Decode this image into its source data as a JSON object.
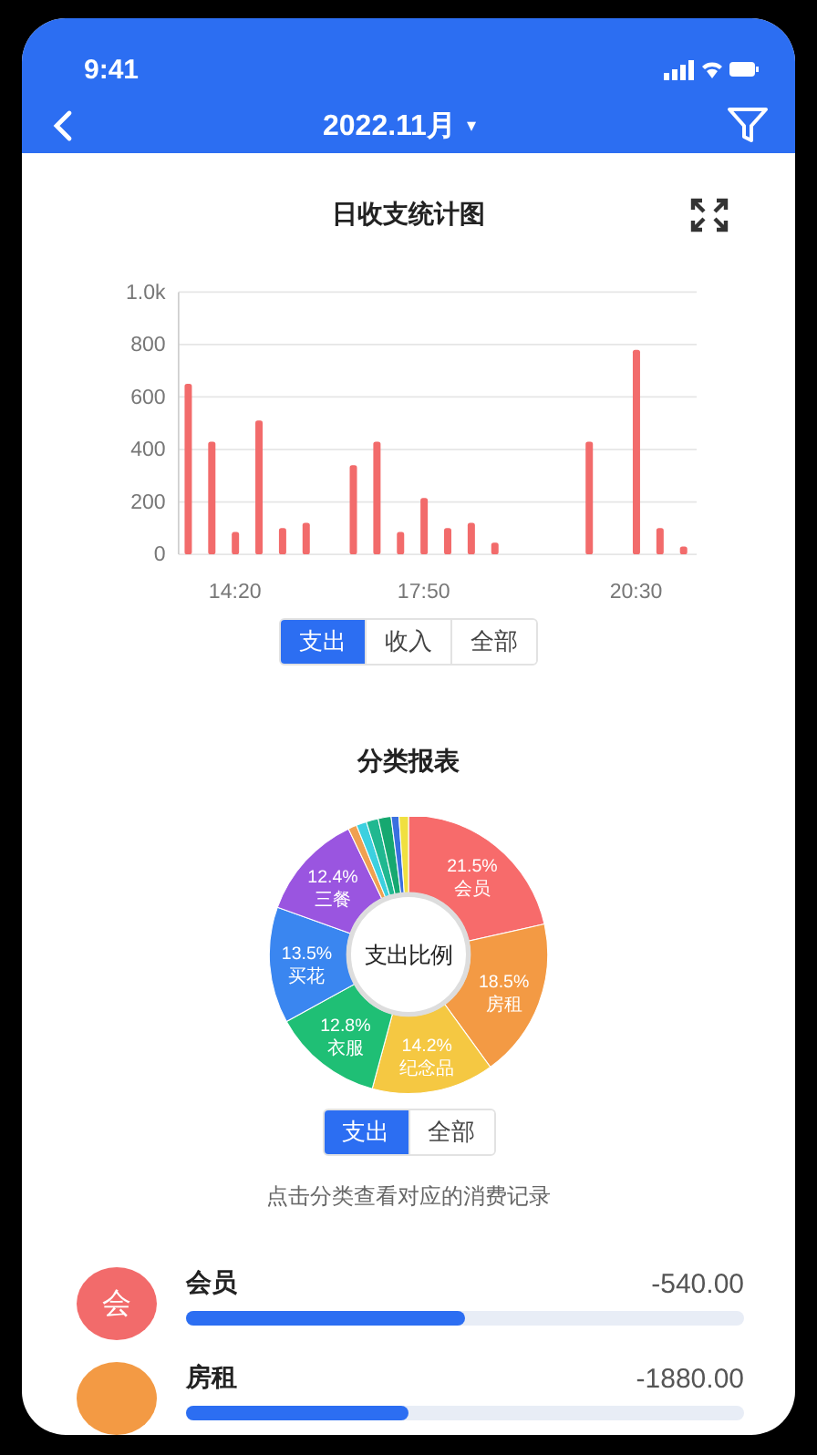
{
  "status_bar": {
    "time": "9:41"
  },
  "nav": {
    "title": "2022.11月",
    "caret": "▾"
  },
  "daily_chart": {
    "title": "日收支统计图",
    "chart_data": {
      "type": "bar",
      "grid": true,
      "categories": [
        null,
        null,
        "14:20",
        null,
        null,
        null,
        null,
        null,
        null,
        null,
        "17:50",
        null,
        null,
        null,
        null,
        null,
        null,
        null,
        null,
        "20:30",
        null,
        null
      ],
      "series": [
        {
          "color": "#f26b6b",
          "values": [
            650,
            430,
            85,
            510,
            100,
            120,
            null,
            340,
            430,
            85,
            215,
            100,
            120,
            45,
            null,
            null,
            null,
            430,
            null,
            780,
            100,
            30
          ]
        }
      ],
      "ylim": [
        0,
        1000
      ],
      "yticks": [
        0,
        200,
        400,
        600,
        800,
        {
          "value": 1000,
          "label": "1.0k"
        }
      ]
    }
  },
  "chart_tabs": [
    {
      "label": "支出",
      "selected": true
    },
    {
      "label": "收入",
      "selected": false
    },
    {
      "label": "全部",
      "selected": false
    }
  ],
  "category_report": {
    "title": "分类报表",
    "chart_data": {
      "type": "donut",
      "title": "支出比例",
      "categories": [
        "会员",
        "房租",
        "纪念品",
        "衣服",
        "买花",
        "三餐",
        null,
        null,
        null,
        null,
        null,
        null
      ],
      "values": [
        21.5,
        18.5,
        14.2,
        12.8,
        13.5,
        12.4,
        1.0,
        1.2,
        1.4,
        1.5,
        0.9,
        1.1
      ],
      "colors": [
        "#f76b6b",
        "#f39a44",
        "#f5c842",
        "#1fbf75",
        "#3a86f0",
        "#9a55e0",
        "#f0a050",
        "#3cd0e0",
        "#20b890",
        "#16a870",
        "#3a70e0",
        "#f0e040"
      ],
      "value_labels": [
        "21.5%",
        "18.5%",
        "14.2%",
        "12.8%",
        "13.5%",
        "12.4%",
        null,
        null,
        null,
        null,
        null,
        null
      ]
    }
  },
  "report_tabs": [
    {
      "label": "支出",
      "selected": true
    },
    {
      "label": "全部",
      "selected": false
    }
  ],
  "hint": "点击分类查看对应的消费记录",
  "records": [
    {
      "avatar": "会",
      "name": "会员",
      "amount": "-540.00",
      "level": 0.5,
      "color": "#f26b6b"
    },
    {
      "name": "房租",
      "amount": "-1880.00",
      "level": 0.4,
      "color": "#f39a44"
    }
  ]
}
